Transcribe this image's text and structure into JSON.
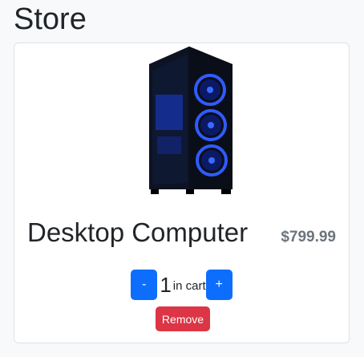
{
  "page": {
    "title": "Store"
  },
  "product": {
    "name": "Desktop Computer",
    "price": "$799.99",
    "image_description_icon": "pc-tower-image"
  },
  "cart": {
    "decrement_label": "-",
    "quantity": "1",
    "in_cart_label": "in cart",
    "increment_label": "+",
    "remove_label": "Remove"
  },
  "colors": {
    "primary": "#0d6efd",
    "danger": "#dc3545",
    "price": "#6c757d",
    "background": "#f8f9fa"
  }
}
